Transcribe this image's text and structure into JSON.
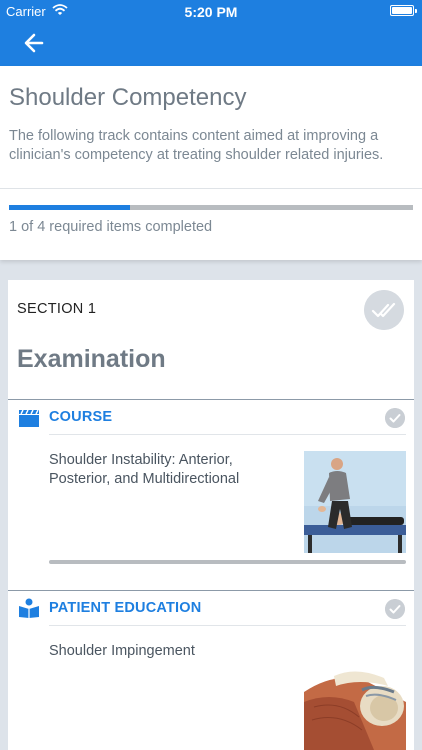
{
  "status_bar": {
    "carrier": "Carrier",
    "time": "5:20 PM"
  },
  "header": {
    "back_icon": "arrow-left-icon",
    "accent_color": "#1e7fe0"
  },
  "track": {
    "title": "Shoulder Competency",
    "description": "The following track contains content aimed at improving a clinician's competency at treating shoulder related injuries.",
    "progress_fraction": 0.3,
    "progress_text": "1 of 4 required items completed"
  },
  "section": {
    "label": "SECTION 1",
    "title": "Examination",
    "check_icon": "double-check-icon",
    "items": [
      {
        "type": "COURSE",
        "icon": "clapperboard-icon",
        "title": "Shoulder Instability: Anterior, Posterior, and Multidirectional",
        "thumbnail": "clinician-examining-patient-photo",
        "check_icon": "check-icon",
        "progress_fraction": 0
      },
      {
        "type": "PATIENT EDUCATION",
        "icon": "reader-book-icon",
        "title": "Shoulder Impingement",
        "thumbnail": "shoulder-anatomy-illustration",
        "check_icon": "check-icon"
      }
    ]
  }
}
